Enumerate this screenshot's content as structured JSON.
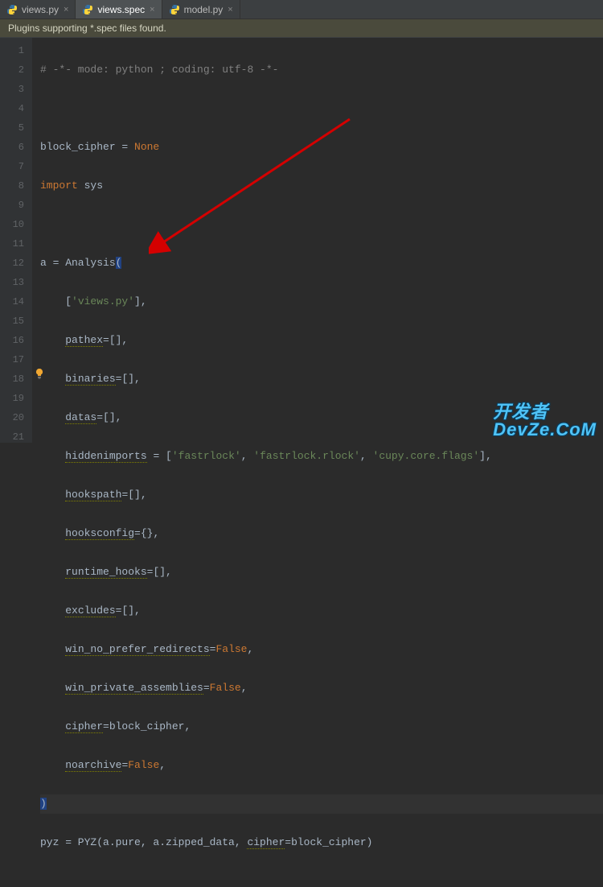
{
  "tabs": [
    {
      "label": "views.py",
      "active": false
    },
    {
      "label": "views.spec",
      "active": true
    },
    {
      "label": "model.py",
      "active": false
    }
  ],
  "banner": "Plugins supporting *.spec files found.",
  "lines": {
    "1": [
      "# -*- mode: python ; coding: utf-8 -*-"
    ],
    "2": [
      ""
    ],
    "3": [
      "block_cipher = ",
      "None"
    ],
    "4": [
      "import",
      " sys"
    ],
    "5": [
      ""
    ],
    "6": [
      "a = Analysis",
      "("
    ],
    "7": [
      "    [",
      "'views.py'",
      "],"
    ],
    "8": [
      "    ",
      "pathex",
      "=[],"
    ],
    "9": [
      "    ",
      "binaries",
      "=[],"
    ],
    "10": [
      "    ",
      "datas",
      "=[],"
    ],
    "11": [
      "    ",
      "hiddenimports",
      " = [",
      "'fastrlock'",
      ", ",
      "'fastrlock.rlock'",
      ", ",
      "'cupy.core.flags'",
      "],"
    ],
    "12": [
      "    ",
      "hookspath",
      "=[],"
    ],
    "13": [
      "    ",
      "hooksconfig",
      "={},"
    ],
    "14": [
      "    ",
      "runtime_hooks",
      "=[],"
    ],
    "15": [
      "    ",
      "excludes",
      "=[],"
    ],
    "16": [
      "    ",
      "win_no_prefer_redirects",
      "=",
      "False",
      ","
    ],
    "17": [
      "    ",
      "win_private_assemblies",
      "=",
      "False",
      ","
    ],
    "18": [
      "    ",
      "cipher",
      "=block_cipher,"
    ],
    "19": [
      "    ",
      "noarchive",
      "=",
      "False",
      ","
    ],
    "20": [
      ")"
    ],
    "21": [
      "pyz = PYZ(a.pure, a.zipped_data, ",
      "cipher",
      "=block_cipher)"
    ]
  },
  "gutter": [
    "1",
    "2",
    "3",
    "4",
    "5",
    "6",
    "7",
    "8",
    "9",
    "10",
    "11",
    "12",
    "13",
    "14",
    "15",
    "16",
    "17",
    "18",
    "19",
    "20",
    "21"
  ],
  "watermark": {
    "line1": "开发者",
    "line2": "DevZe.CoM"
  }
}
